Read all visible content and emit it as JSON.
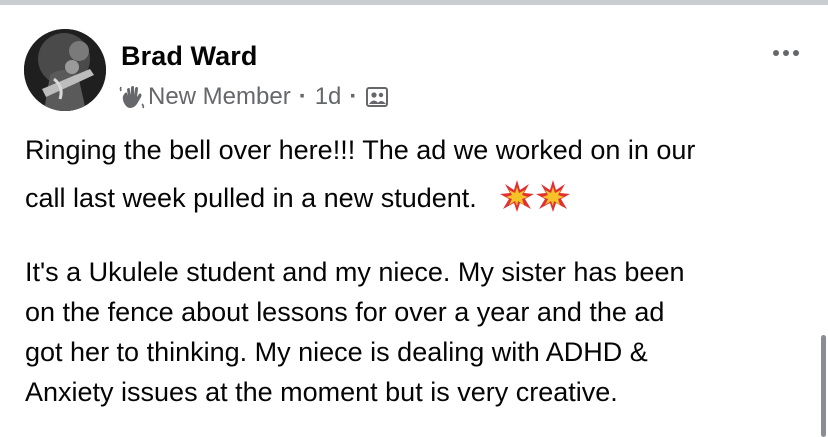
{
  "post": {
    "author": "Brad Ward",
    "badge": "New Member",
    "timestamp": "1d",
    "separator": "·",
    "paragraph1_lines": [
      "Ringing the bell over here!!!  The ad we worked on in our",
      "call last week pulled in a new student."
    ],
    "paragraph2_lines": [
      "It's a Ukulele student and my niece.  My sister has been",
      "on the fence about lessons for over a year and the ad",
      "got her to thinking.  My niece is dealing with ADHD &",
      "Anxiety issues at the moment but is very creative."
    ]
  },
  "icons": {
    "badge_icon": "waving-hand-icon",
    "audience_icon": "group-members-icon",
    "more_icon": "more-options-icon",
    "emoji": "collision-emoji"
  },
  "colors": {
    "text_primary": "#050505",
    "text_secondary": "#65676b",
    "emoji_red": "#e0312f",
    "emoji_yellow": "#f6c22a"
  }
}
